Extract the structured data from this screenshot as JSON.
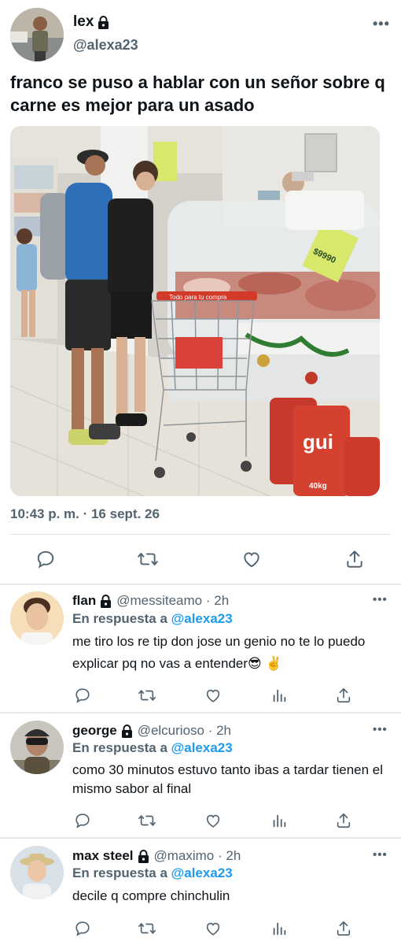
{
  "main_tweet": {
    "name": "lex",
    "handle": "@alexa23",
    "text": "franco se puso a hablar con un señor sobre q carne es mejor para un asado",
    "timestamp": "10:43 p. m. · 16 sept. 26",
    "media": {
      "sign_text": "$9990",
      "cart_text": "Todo para tu compra",
      "bag_text": "gui",
      "bag_subtext": "40kg"
    }
  },
  "replies": [
    {
      "name": "flan",
      "handle": "@messiteamo · 2h",
      "in_reply_prefix": "En respuesta a ",
      "in_reply_mention": "@alexa23",
      "text": "me tiro los re tip don jose un genio no te lo puedo explicar pq no vas a entender😎 ✌️"
    },
    {
      "name": "george",
      "handle": "@elcurioso · 2h",
      "in_reply_prefix": "En respuesta a ",
      "in_reply_mention": "@alexa23",
      "text": "como 30 minutos estuvo tanto ibas a tardar tienen el mismo sabor al final"
    },
    {
      "name": "max steel",
      "handle": "@maximo · 2h",
      "in_reply_prefix": "En respuesta a ",
      "in_reply_mention": "@alexa23",
      "text": "decile q compre chinchulin"
    }
  ],
  "colors": {
    "accent": "#1d9bf0",
    "secondary_text": "#536471",
    "primary_text": "#0f1419"
  },
  "icons": [
    "lock-icon",
    "more-icon",
    "reply-icon",
    "retweet-icon",
    "like-icon",
    "views-icon",
    "share-icon"
  ]
}
